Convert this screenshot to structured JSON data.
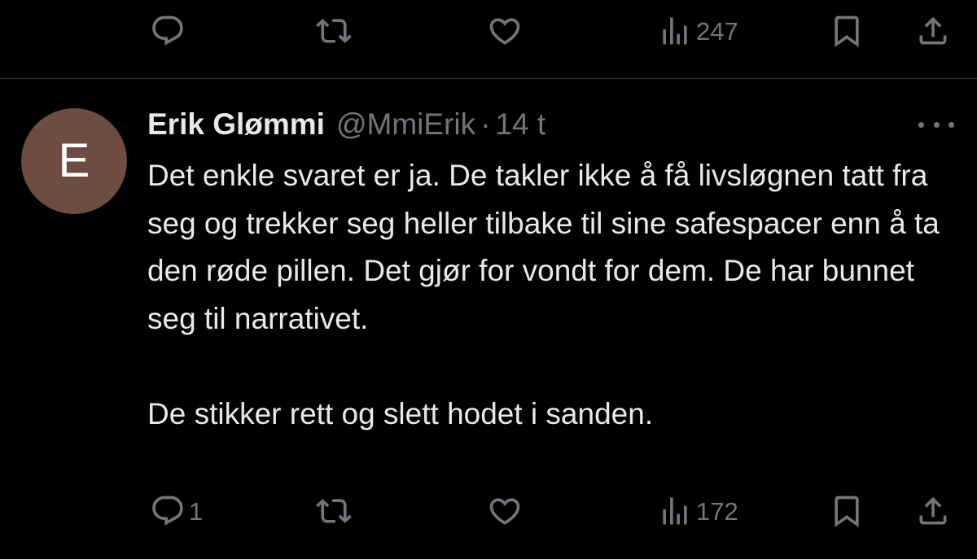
{
  "top_actions": {
    "reply_count": "",
    "retweet_count": "",
    "like_count": "",
    "views_count": "247"
  },
  "tweet": {
    "avatar_letter": "E",
    "avatar_color": "#6d4c41",
    "author_name": "Erik Glømmi",
    "handle": "@MmiErik",
    "separator": "·",
    "time": "14 t",
    "paragraphs": [
      "Det enkle svaret er ja. De takler ikke å få livsløgnen tatt fra seg og trekker seg heller tilbake til sine safespacer enn å ta den røde pillen. Det gjør for vondt for dem. De har bunnet seg til narrativet.",
      "De stikker rett og slett hodet i sanden."
    ],
    "actions": {
      "reply_count": "1",
      "retweet_count": "",
      "like_count": "",
      "views_count": "172"
    }
  },
  "icons": [
    "reply-icon",
    "retweet-icon",
    "like-icon",
    "views-icon",
    "bookmark-icon",
    "share-icon",
    "more-icon"
  ],
  "colors": {
    "background": "#000000",
    "text": "#e7e9ea",
    "secondary": "#71767b",
    "divider": "#2f3336"
  }
}
